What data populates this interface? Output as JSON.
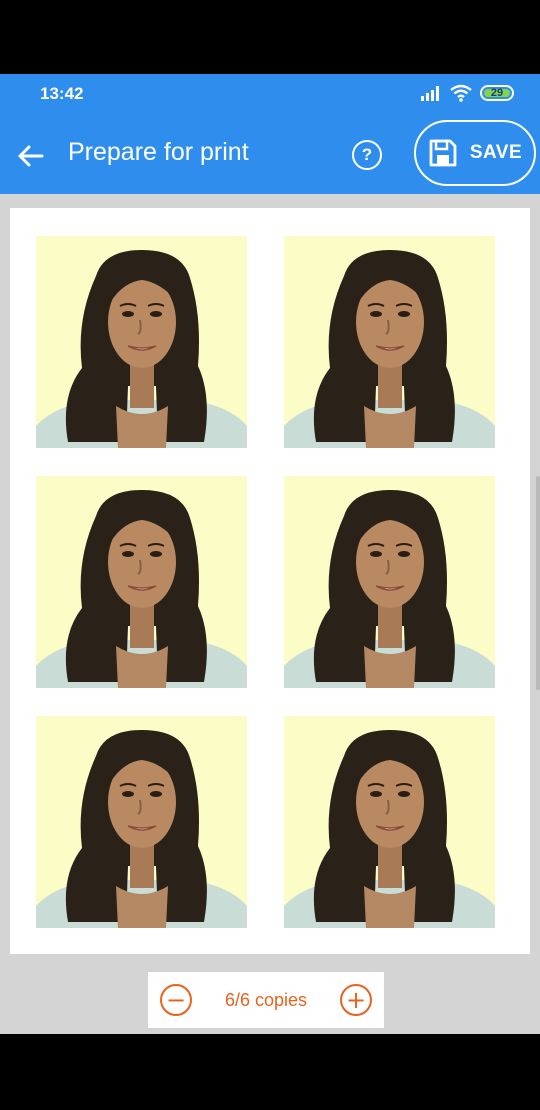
{
  "status_bar": {
    "time": "13:42",
    "battery": "29"
  },
  "app_bar": {
    "title": "Prepare for print",
    "help_label": "?",
    "save_label": "SAVE"
  },
  "colors": {
    "primary": "#2f8eed",
    "accent": "#e8621c",
    "photo_background": "#fcfcc6"
  },
  "icons": {
    "back": "arrow-left-icon",
    "help": "question-circle-icon",
    "save": "floppy-disk-icon",
    "decrease": "minus-circle-icon",
    "increase": "plus-circle-icon"
  },
  "photos": [
    {
      "label": "passport-photo-1"
    },
    {
      "label": "passport-photo-2"
    },
    {
      "label": "passport-photo-3"
    },
    {
      "label": "passport-photo-4"
    },
    {
      "label": "passport-photo-5"
    },
    {
      "label": "passport-photo-6"
    }
  ],
  "copies": {
    "text": "6/6 copies",
    "minus": "−",
    "plus": "+"
  }
}
